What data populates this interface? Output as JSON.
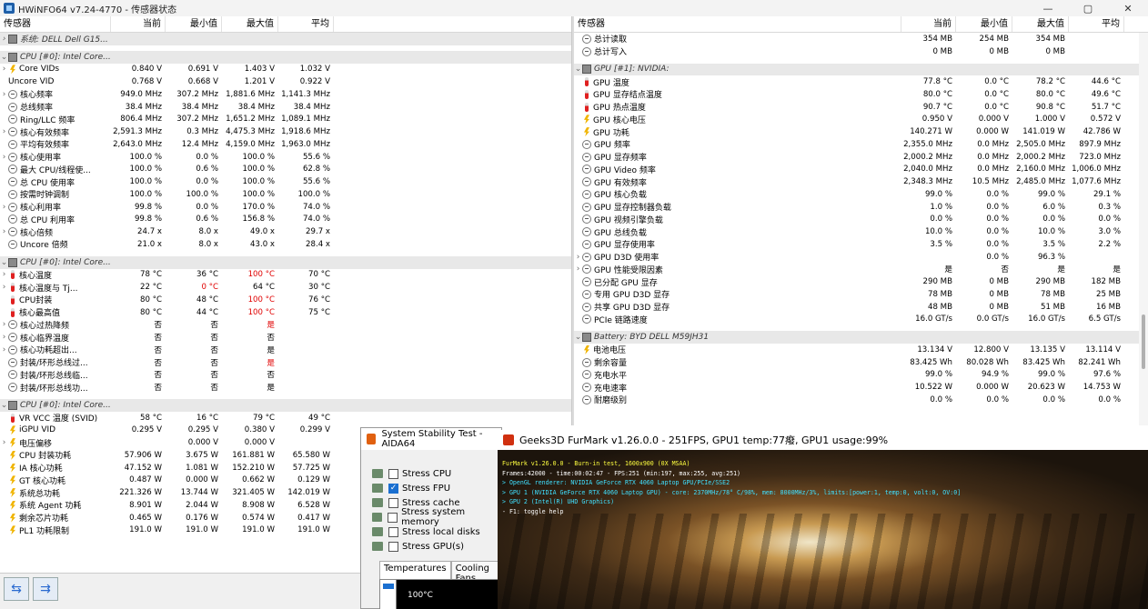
{
  "window": {
    "title": "HWiNFO64 v7.24-4770 - 传感器状态",
    "controls": [
      "—",
      "▢",
      "✕"
    ]
  },
  "columns": {
    "sensor": "传感器",
    "current": "当前",
    "min": "最小值",
    "max": "最大值",
    "avg": "平均"
  },
  "left_rows": [
    {
      "kind": "group",
      "exp": "›",
      "label": "系统: DELL Dell G15..."
    },
    {
      "kind": "blank"
    },
    {
      "kind": "group",
      "exp": "⌄",
      "label": "CPU [#0]: Intel Core..."
    },
    {
      "kind": "row",
      "exp": "›",
      "icon": "bolt",
      "label": "Core VIDs",
      "vals": [
        "0.840 V",
        "0.691 V",
        "1.403 V",
        "1.032 V"
      ]
    },
    {
      "kind": "row",
      "exp": "",
      "icon": "none",
      "label": "Uncore VID",
      "vals": [
        "0.768 V",
        "0.668 V",
        "1.201 V",
        "0.922 V"
      ]
    },
    {
      "kind": "row",
      "exp": "›",
      "icon": "clock",
      "label": "核心频率",
      "vals": [
        "949.0 MHz",
        "307.2 MHz",
        "1,881.6 MHz",
        "1,141.3 MHz"
      ]
    },
    {
      "kind": "row",
      "exp": "",
      "icon": "clock",
      "label": "总线频率",
      "vals": [
        "38.4 MHz",
        "38.4 MHz",
        "38.4 MHz",
        "38.4 MHz"
      ]
    },
    {
      "kind": "row",
      "exp": "",
      "icon": "clock",
      "label": "Ring/LLC 频率",
      "vals": [
        "806.4 MHz",
        "307.2 MHz",
        "1,651.2 MHz",
        "1,089.1 MHz"
      ]
    },
    {
      "kind": "row",
      "exp": "›",
      "icon": "clock",
      "label": "核心有效频率",
      "vals": [
        "2,591.3 MHz",
        "0.3 MHz",
        "4,475.3 MHz",
        "1,918.6 MHz"
      ]
    },
    {
      "kind": "row",
      "exp": "",
      "icon": "clock",
      "label": "平均有效频率",
      "vals": [
        "2,643.0 MHz",
        "12.4 MHz",
        "4,159.0 MHz",
        "1,963.0 MHz"
      ]
    },
    {
      "kind": "row",
      "exp": "›",
      "icon": "clock",
      "label": "核心使用率",
      "vals": [
        "100.0 %",
        "0.0 %",
        "100.0 %",
        "55.6 %"
      ]
    },
    {
      "kind": "row",
      "exp": "",
      "icon": "clock",
      "label": "最大 CPU/线程使...",
      "vals": [
        "100.0 %",
        "0.6 %",
        "100.0 %",
        "62.8 %"
      ]
    },
    {
      "kind": "row",
      "exp": "",
      "icon": "clock",
      "label": "总 CPU 使用率",
      "vals": [
        "100.0 %",
        "0.0 %",
        "100.0 %",
        "55.6 %"
      ]
    },
    {
      "kind": "row",
      "exp": "",
      "icon": "clock",
      "label": "按需时钟调制",
      "vals": [
        "100.0 %",
        "100.0 %",
        "100.0 %",
        "100.0 %"
      ]
    },
    {
      "kind": "row",
      "exp": "›",
      "icon": "clock",
      "label": "核心利用率",
      "vals": [
        "99.8 %",
        "0.0 %",
        "170.0 %",
        "74.0 %"
      ]
    },
    {
      "kind": "row",
      "exp": "",
      "icon": "clock",
      "label": "总 CPU 利用率",
      "vals": [
        "99.8 %",
        "0.6 %",
        "156.8 %",
        "74.0 %"
      ]
    },
    {
      "kind": "row",
      "exp": "›",
      "icon": "clock",
      "label": "核心倍频",
      "vals": [
        "24.7 x",
        "8.0 x",
        "49.0 x",
        "29.7 x"
      ]
    },
    {
      "kind": "row",
      "exp": "",
      "icon": "clock",
      "label": "Uncore 倍频",
      "vals": [
        "21.0 x",
        "8.0 x",
        "43.0 x",
        "28.4 x"
      ]
    },
    {
      "kind": "blank"
    },
    {
      "kind": "group",
      "exp": "⌄",
      "label": "CPU [#0]: Intel Core..."
    },
    {
      "kind": "row",
      "exp": "›",
      "icon": "therm",
      "label": "核心温度",
      "vals": [
        "78 °C",
        "36 °C",
        "100 °C",
        "70 °C"
      ],
      "red": [
        2
      ]
    },
    {
      "kind": "row",
      "exp": "›",
      "icon": "therm",
      "label": "核心温度与 Tj...",
      "vals": [
        "22 °C",
        "0 °C",
        "64 °C",
        "30 °C"
      ],
      "red": [
        1
      ]
    },
    {
      "kind": "row",
      "exp": "",
      "icon": "therm",
      "label": "CPU封装",
      "vals": [
        "80 °C",
        "48 °C",
        "100 °C",
        "76 °C"
      ],
      "red": [
        2
      ]
    },
    {
      "kind": "row",
      "exp": "",
      "icon": "therm",
      "label": "核心最高值",
      "vals": [
        "80 °C",
        "44 °C",
        "100 °C",
        "75 °C"
      ],
      "red": [
        2
      ]
    },
    {
      "kind": "row",
      "exp": "›",
      "icon": "clock",
      "label": "核心过热降频",
      "vals": [
        "否",
        "否",
        "是",
        ""
      ],
      "red": [
        2
      ]
    },
    {
      "kind": "row",
      "exp": "›",
      "icon": "clock",
      "label": "核心临界温度",
      "vals": [
        "否",
        "否",
        "否",
        ""
      ]
    },
    {
      "kind": "row",
      "exp": "›",
      "icon": "clock",
      "label": "核心功耗超出...",
      "vals": [
        "否",
        "否",
        "是",
        ""
      ]
    },
    {
      "kind": "row",
      "exp": "",
      "icon": "clock",
      "label": "封装/环形总线过...",
      "vals": [
        "否",
        "否",
        "是",
        ""
      ],
      "red": [
        2
      ]
    },
    {
      "kind": "row",
      "exp": "",
      "icon": "clock",
      "label": "封装/环形总线临...",
      "vals": [
        "否",
        "否",
        "否",
        ""
      ]
    },
    {
      "kind": "row",
      "exp": "",
      "icon": "clock",
      "label": "封装/环形总线功...",
      "vals": [
        "否",
        "否",
        "是",
        ""
      ]
    },
    {
      "kind": "blank"
    },
    {
      "kind": "group",
      "exp": "⌄",
      "label": "CPU [#0]: Intel Core..."
    },
    {
      "kind": "row",
      "exp": "",
      "icon": "therm",
      "label": "VR VCC 温度 (SVID)",
      "vals": [
        "58 °C",
        "16 °C",
        "79 °C",
        "49 °C"
      ]
    },
    {
      "kind": "row",
      "exp": "",
      "icon": "bolt",
      "label": "iGPU VID",
      "vals": [
        "0.295 V",
        "0.295 V",
        "0.380 V",
        "0.299 V"
      ]
    },
    {
      "kind": "row",
      "exp": "›",
      "icon": "bolt",
      "label": "电压偏移",
      "vals": [
        "",
        "0.000 V",
        "0.000 V",
        ""
      ]
    },
    {
      "kind": "row",
      "exp": "",
      "icon": "bolt",
      "label": "CPU 封装功耗",
      "vals": [
        "57.906 W",
        "3.675 W",
        "161.881 W",
        "65.580 W"
      ]
    },
    {
      "kind": "row",
      "exp": "",
      "icon": "bolt",
      "label": "IA 核心功耗",
      "vals": [
        "47.152 W",
        "1.081 W",
        "152.210 W",
        "57.725 W"
      ]
    },
    {
      "kind": "row",
      "exp": "",
      "icon": "bolt",
      "label": "GT 核心功耗",
      "vals": [
        "0.487 W",
        "0.000 W",
        "0.662 W",
        "0.129 W"
      ]
    },
    {
      "kind": "row",
      "exp": "",
      "icon": "bolt",
      "label": "系统总功耗",
      "vals": [
        "221.326 W",
        "13.744 W",
        "321.405 W",
        "142.019 W"
      ]
    },
    {
      "kind": "row",
      "exp": "",
      "icon": "bolt",
      "label": "系统 Agent 功耗",
      "vals": [
        "8.901 W",
        "2.044 W",
        "8.908 W",
        "6.528 W"
      ]
    },
    {
      "kind": "row",
      "exp": "",
      "icon": "bolt",
      "label": "剩余芯片功耗",
      "vals": [
        "0.465 W",
        "0.176 W",
        "0.574 W",
        "0.417 W"
      ]
    },
    {
      "kind": "row",
      "exp": "",
      "icon": "bolt",
      "label": "PL1 功耗限制",
      "vals": [
        "191.0 W",
        "191.0 W",
        "191.0 W",
        "191.0 W"
      ]
    }
  ],
  "right_rows": [
    {
      "kind": "row",
      "exp": "",
      "icon": "clock",
      "label": "总计读取",
      "vals": [
        "354 MB",
        "254 MB",
        "354 MB",
        ""
      ]
    },
    {
      "kind": "row",
      "exp": "",
      "icon": "clock",
      "label": "总计写入",
      "vals": [
        "0 MB",
        "0 MB",
        "0 MB",
        ""
      ]
    },
    {
      "kind": "blank"
    },
    {
      "kind": "group",
      "exp": "⌄",
      "label": "GPU [#1]: NVIDIA:"
    },
    {
      "kind": "row",
      "exp": "",
      "icon": "therm",
      "label": "GPU 温度",
      "vals": [
        "77.8 °C",
        "0.0 °C",
        "78.2 °C",
        "44.6 °C"
      ]
    },
    {
      "kind": "row",
      "exp": "",
      "icon": "therm",
      "label": "GPU 显存结点温度",
      "vals": [
        "80.0 °C",
        "0.0 °C",
        "80.0 °C",
        "49.6 °C"
      ]
    },
    {
      "kind": "row",
      "exp": "",
      "icon": "therm",
      "label": "GPU 热点温度",
      "vals": [
        "90.7 °C",
        "0.0 °C",
        "90.8 °C",
        "51.7 °C"
      ]
    },
    {
      "kind": "row",
      "exp": "",
      "icon": "bolt",
      "label": "GPU 核心电压",
      "vals": [
        "0.950 V",
        "0.000 V",
        "1.000 V",
        "0.572 V"
      ]
    },
    {
      "kind": "row",
      "exp": "",
      "icon": "bolt",
      "label": "GPU 功耗",
      "vals": [
        "140.271 W",
        "0.000 W",
        "141.019 W",
        "42.786 W"
      ]
    },
    {
      "kind": "row",
      "exp": "",
      "icon": "clock",
      "label": "GPU 频率",
      "vals": [
        "2,355.0 MHz",
        "0.0 MHz",
        "2,505.0 MHz",
        "897.9 MHz"
      ]
    },
    {
      "kind": "row",
      "exp": "",
      "icon": "clock",
      "label": "GPU 显存频率",
      "vals": [
        "2,000.2 MHz",
        "0.0 MHz",
        "2,000.2 MHz",
        "723.0 MHz"
      ]
    },
    {
      "kind": "row",
      "exp": "",
      "icon": "clock",
      "label": "GPU Video 频率",
      "vals": [
        "2,040.0 MHz",
        "0.0 MHz",
        "2,160.0 MHz",
        "1,006.0 MHz"
      ]
    },
    {
      "kind": "row",
      "exp": "",
      "icon": "clock",
      "label": "GPU 有效频率",
      "vals": [
        "2,348.3 MHz",
        "10.5 MHz",
        "2,485.0 MHz",
        "1,077.6 MHz"
      ]
    },
    {
      "kind": "row",
      "exp": "",
      "icon": "clock",
      "label": "GPU 核心负载",
      "vals": [
        "99.0 %",
        "0.0 %",
        "99.0 %",
        "29.1 %"
      ]
    },
    {
      "kind": "row",
      "exp": "",
      "icon": "clock",
      "label": "GPU 显存控制器负载",
      "vals": [
        "1.0 %",
        "0.0 %",
        "6.0 %",
        "0.3 %"
      ]
    },
    {
      "kind": "row",
      "exp": "",
      "icon": "clock",
      "label": "GPU 视频引擎负载",
      "vals": [
        "0.0 %",
        "0.0 %",
        "0.0 %",
        "0.0 %"
      ]
    },
    {
      "kind": "row",
      "exp": "",
      "icon": "clock",
      "label": "GPU 总线负载",
      "vals": [
        "10.0 %",
        "0.0 %",
        "10.0 %",
        "3.0 %"
      ]
    },
    {
      "kind": "row",
      "exp": "",
      "icon": "clock",
      "label": "GPU 显存使用率",
      "vals": [
        "3.5 %",
        "0.0 %",
        "3.5 %",
        "2.2 %"
      ]
    },
    {
      "kind": "row",
      "exp": "›",
      "icon": "clock",
      "label": "GPU D3D 使用率",
      "vals": [
        "",
        "0.0 %",
        "96.3 %",
        ""
      ]
    },
    {
      "kind": "row",
      "exp": "›",
      "icon": "clock",
      "label": "GPU 性能受限因素",
      "vals": [
        "是",
        "否",
        "是",
        "是"
      ]
    },
    {
      "kind": "row",
      "exp": "",
      "icon": "clock",
      "label": "已分配 GPU 显存",
      "vals": [
        "290 MB",
        "0 MB",
        "290 MB",
        "182 MB"
      ]
    },
    {
      "kind": "row",
      "exp": "",
      "icon": "clock",
      "label": "专用 GPU D3D 显存",
      "vals": [
        "78 MB",
        "0 MB",
        "78 MB",
        "25 MB"
      ]
    },
    {
      "kind": "row",
      "exp": "",
      "icon": "clock",
      "label": "共享 GPU D3D 显存",
      "vals": [
        "48 MB",
        "0 MB",
        "51 MB",
        "16 MB"
      ]
    },
    {
      "kind": "row",
      "exp": "",
      "icon": "clock",
      "label": "PCIe 链路速度",
      "vals": [
        "16.0 GT/s",
        "0.0 GT/s",
        "16.0 GT/s",
        "6.5 GT/s"
      ]
    },
    {
      "kind": "blank"
    },
    {
      "kind": "group",
      "exp": "⌄",
      "label": "Battery: BYD DELL M59JH31"
    },
    {
      "kind": "row",
      "exp": "",
      "icon": "bolt",
      "label": "电池电压",
      "vals": [
        "13.134 V",
        "12.800 V",
        "13.135 V",
        "13.114 V"
      ]
    },
    {
      "kind": "row",
      "exp": "",
      "icon": "clock",
      "label": "剩余容量",
      "vals": [
        "83.425 Wh",
        "80.028 Wh",
        "83.425 Wh",
        "82.241 Wh"
      ]
    },
    {
      "kind": "row",
      "exp": "",
      "icon": "clock",
      "label": "充电水平",
      "vals": [
        "99.0 %",
        "94.9 %",
        "99.0 %",
        "97.6 %"
      ]
    },
    {
      "kind": "row",
      "exp": "",
      "icon": "clock",
      "label": "充电速率",
      "vals": [
        "10.522 W",
        "0.000 W",
        "20.623 W",
        "14.753 W"
      ]
    },
    {
      "kind": "row",
      "exp": "",
      "icon": "clock",
      "label": "耐磨级别",
      "vals": [
        "0.0 %",
        "0.0 %",
        "0.0 %",
        "0.0 %"
      ]
    }
  ],
  "bottom_nav": {
    "icon_left": "⇆",
    "icon_right": "⇉"
  },
  "aida": {
    "title": "System Stability Test - AIDA64",
    "options": [
      {
        "label": "Stress CPU",
        "checked": false
      },
      {
        "label": "Stress FPU",
        "checked": true
      },
      {
        "label": "Stress cache",
        "checked": false
      },
      {
        "label": "Stress system memory",
        "checked": false
      },
      {
        "label": "Stress local disks",
        "checked": false
      },
      {
        "label": "Stress GPU(s)",
        "checked": false
      }
    ],
    "tabs": [
      "Temperatures",
      "Cooling Fans"
    ],
    "graph_label": "100°C"
  },
  "furmark": {
    "title": "Geeks3D FurMark v1.26.0.0 - 251FPS, GPU1 temp:77癈, GPU1 usage:99%",
    "lines": [
      {
        "c": "y",
        "t": "FurMark v1.26.0.0 - Burn-in test, 1600x900 (0X MSAA)"
      },
      {
        "c": "w",
        "t": "Frames:42000 - time:00:02:47 - FPS:251 (min:197, max:255, avg:251)"
      },
      {
        "c": "c",
        "t": "> OpenGL renderer: NVIDIA GeForce RTX 4060 Laptop GPU/PCIe/SSE2"
      },
      {
        "c": "c",
        "t": "> GPU 1 (NVIDIA GeForce RTX 4060 Laptop GPU) - core: 2370MHz/78° C/98%, mem: 8000MHz/3%, limits:[power:1, temp:0, volt:0, OV:0]"
      },
      {
        "c": "c",
        "t": "> GPU 2 (Intel(R) UHD Graphics)"
      },
      {
        "c": "w",
        "t": "- F1: toggle help"
      }
    ]
  }
}
